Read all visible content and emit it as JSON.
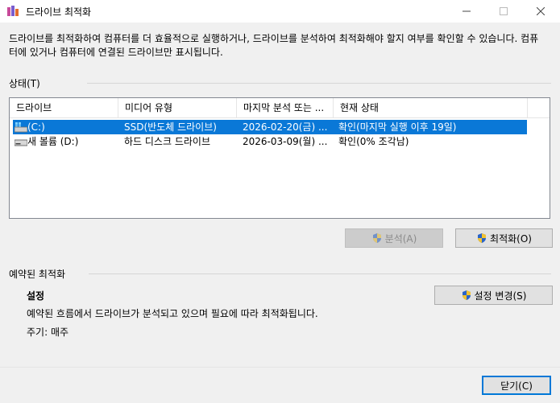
{
  "window": {
    "title": "드라이브 최적화",
    "minimize_icon": "minimize-icon",
    "maximize_icon": "maximize-icon",
    "close_icon": "close-icon"
  },
  "description": "드라이브를 최적화하여 컴퓨터를 더 효율적으로 실행하거나, 드라이브를 분석하여 최적화해야 할지 여부를 확인할 수 있습니다. 컴퓨터에 있거나 컴퓨터에 연결된 드라이브만 표시됩니다.",
  "status": {
    "label": "상태(T)",
    "columns": [
      "드라이브",
      "미디어 유형",
      "마지막 분석 또는 ...",
      "현재 상태"
    ],
    "rows": [
      {
        "drive": "(C:)",
        "media": "SSD(반도체 드라이브)",
        "last": "2026-02-20(금) ...",
        "state": "확인(마지막 실행 이후 19일)",
        "icon": "windows-drive-icon",
        "selected": true
      },
      {
        "drive": "새 볼륨 (D:)",
        "media": "하드 디스크 드라이브",
        "last": "2026-03-09(월) ...",
        "state": "확인(0% 조각남)",
        "icon": "hard-drive-icon",
        "selected": false
      }
    ],
    "analyze_label": "분석(A)",
    "optimize_label": "최적화(O)"
  },
  "scheduled": {
    "label": "예약된 최적화",
    "settings_title": "설정",
    "settings_desc": "예약된 흐름에서 드라이브가 분석되고 있으며 필요에 따라 최적화됩니다.",
    "frequency": "주기: 매주",
    "change_label": "설정 변경(S)"
  },
  "footer": {
    "close_label": "닫기(C)"
  },
  "colors": {
    "selection": "#0a78d7",
    "background": "#f0f0f0"
  }
}
